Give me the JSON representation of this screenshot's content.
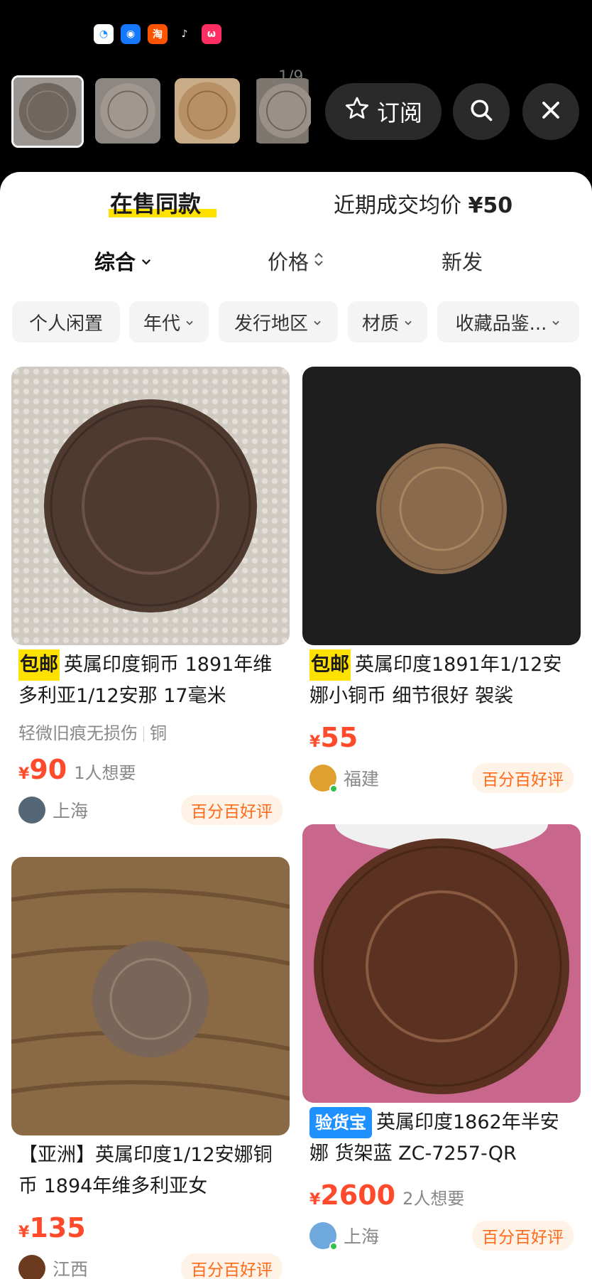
{
  "status_bar": {
    "icons": [
      "qq-browser-icon",
      "qq-icon",
      "taobao-icon",
      "tiktok-icon",
      "weibo-icon"
    ]
  },
  "viewer": {
    "counter": "1/9",
    "subscribe_label": "订阅",
    "thumbnails": [
      "coin-thumb-1",
      "coin-thumb-2",
      "coin-thumb-3",
      "coin-thumb-4"
    ]
  },
  "tabs": {
    "on_sale": "在售同款",
    "recent_avg_label": "近期成交均价",
    "recent_avg_value": "¥50"
  },
  "sort": {
    "comprehensive": "综合",
    "price": "价格",
    "newest": "新发"
  },
  "filters": [
    "个人闲置",
    "年代",
    "发行地区",
    "材质",
    "收藏品鉴..."
  ],
  "listings": [
    {
      "badge": "包邮",
      "title": "英属印度铜币 1891年维多利亚1/12安那 17毫米",
      "condition": "轻微旧痕无损伤",
      "material": "铜",
      "currency": "¥",
      "price": "90",
      "want": "1人想要",
      "location": "上海",
      "rating": "百分百好评"
    },
    {
      "badge": "包邮",
      "title": "英属印度1891年1/12安娜小铜币 细节很好 袈裟",
      "currency": "¥",
      "price": "55",
      "location": "福建",
      "rating": "百分百好评"
    },
    {
      "badge": "",
      "title": "【亚洲】英属印度1/12安娜铜币 1894年维多利亚女",
      "currency": "¥",
      "price": "135",
      "location": "江西",
      "rating": "百分百好评"
    },
    {
      "badge": "验货宝",
      "title": "英属印度1862年半安娜 货架蓝 ZC-7257-QR",
      "currency": "¥",
      "price": "2600",
      "want": "2人想要",
      "location": "上海",
      "rating": "百分百好评"
    }
  ],
  "colors": {
    "accent_yellow": "#ffe100",
    "price_red": "#ff4b2b",
    "rating_orange": "#ff6a1a",
    "inspect_blue": "#1e90ff"
  }
}
